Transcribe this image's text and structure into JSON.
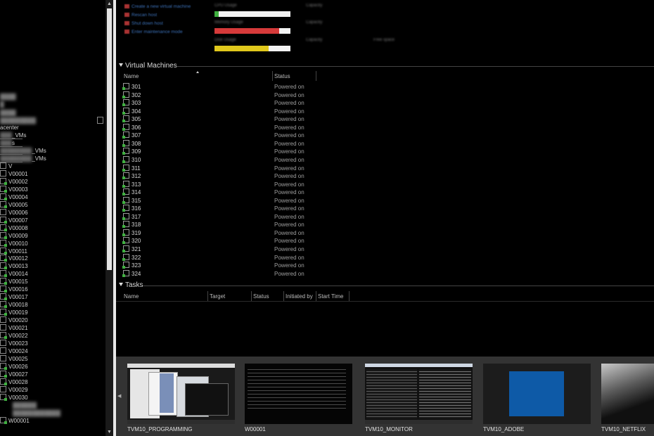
{
  "tree": {
    "blurred_top": [
      "",
      "",
      "",
      "",
      ""
    ],
    "datacenter_label": "acenter",
    "folders": [
      {
        "prefix": "",
        "suffix": "_VMs"
      },
      {
        "prefix": "",
        "suffix": "s"
      },
      {
        "prefix": "",
        "suffix": "_VMs"
      },
      {
        "prefix": "",
        "suffix": "_VMs"
      }
    ],
    "v_folder": "V",
    "vms": [
      "V00001",
      "V00002",
      "V00003",
      "V00004",
      "V00005",
      "V00006",
      "V00007",
      "V00008",
      "V00009",
      "V00010",
      "V00011",
      "V00012",
      "V00013",
      "V00014",
      "V00015",
      "V00016",
      "V00017",
      "V00018",
      "V00019",
      "V00020",
      "V00021",
      "V00022",
      "V00023",
      "V00024",
      "V00025",
      "V00026",
      "V00027",
      "V00028",
      "V00029",
      "V00030"
    ],
    "bottom_vm": "W00001"
  },
  "top_actions": [
    "Create a new virtual machine",
    "Rescan host",
    "Shut down host",
    "Enter maintenance mode"
  ],
  "summary": {
    "bars": [
      {
        "color": "#3fb040",
        "percent": 6
      },
      {
        "color": "#d63a3a",
        "percent": 85
      },
      {
        "color": "#e0c81c",
        "percent": 71
      }
    ],
    "labels": [
      "CPU Usage",
      "Memory Usage",
      "Disk Usage",
      "Capacity",
      "Capacity",
      "Capacity",
      "Free space"
    ]
  },
  "vm_section": {
    "title": "Virtual Machines",
    "columns": [
      "Name",
      "Status"
    ],
    "rows": [
      {
        "name": "301",
        "status": "Powered on"
      },
      {
        "name": "302",
        "status": "Powered on"
      },
      {
        "name": "303",
        "status": "Powered on"
      },
      {
        "name": "304",
        "status": "Powered on"
      },
      {
        "name": "305",
        "status": "Powered on"
      },
      {
        "name": "306",
        "status": "Powered on"
      },
      {
        "name": "307",
        "status": "Powered on"
      },
      {
        "name": "308",
        "status": "Powered on"
      },
      {
        "name": "309",
        "status": "Powered on"
      },
      {
        "name": "310",
        "status": "Powered on"
      },
      {
        "name": "311",
        "status": "Powered on"
      },
      {
        "name": "312",
        "status": "Powered on"
      },
      {
        "name": "313",
        "status": "Powered on"
      },
      {
        "name": "314",
        "status": "Powered on"
      },
      {
        "name": "315",
        "status": "Powered on"
      },
      {
        "name": "316",
        "status": "Powered on"
      },
      {
        "name": "317",
        "status": "Powered on"
      },
      {
        "name": "318",
        "status": "Powered on"
      },
      {
        "name": "319",
        "status": "Powered on"
      },
      {
        "name": "320",
        "status": "Powered on"
      },
      {
        "name": "321",
        "status": "Powered on"
      },
      {
        "name": "322",
        "status": "Powered on"
      },
      {
        "name": "323",
        "status": "Powered on"
      },
      {
        "name": "324",
        "status": "Powered on"
      }
    ]
  },
  "tasks_section": {
    "title": "Tasks",
    "columns": [
      "Name",
      "Target",
      "Status",
      "Initiated by",
      "Start Time"
    ]
  },
  "thumbnails": [
    "TVM10_PROGRAMMING",
    "W00001",
    "TVM10_MONITOR",
    "TVM10_ADOBE",
    "TVM10_NETFLIX"
  ]
}
